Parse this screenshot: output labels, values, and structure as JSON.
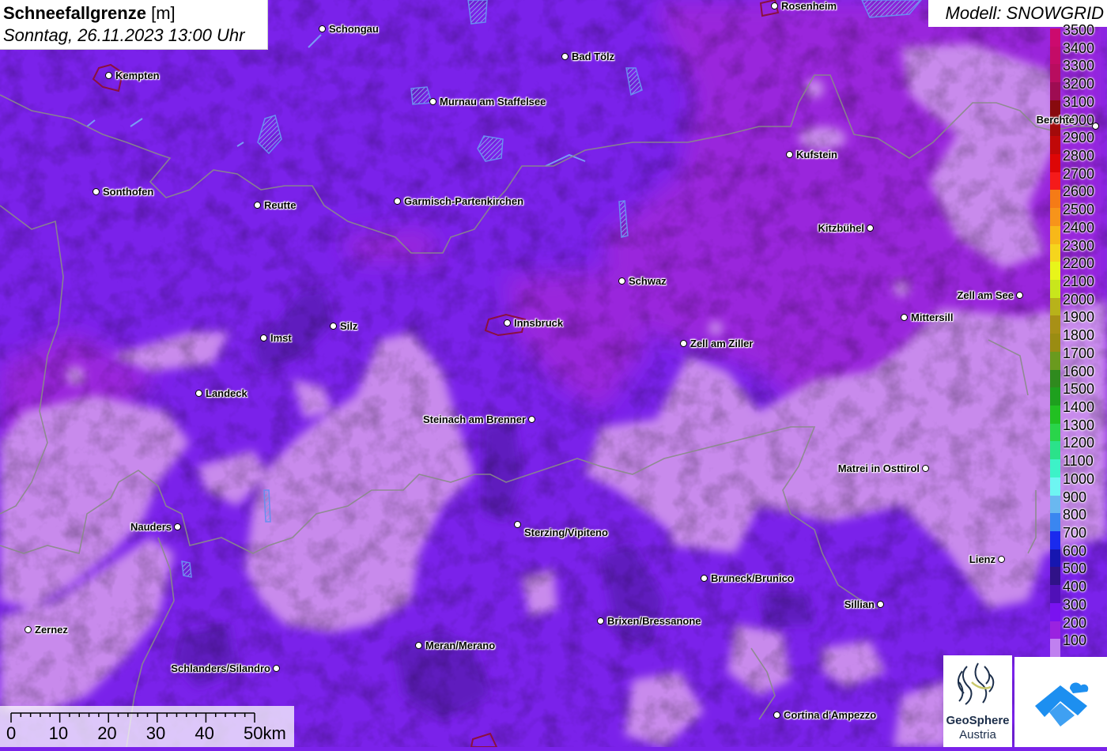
{
  "title": {
    "main": "Schneefallgrenze",
    "unit": "[m]",
    "date": "Sonntag, 26.11.2023 13:00 Uhr"
  },
  "model": {
    "label": "Modell: SNOWGRID"
  },
  "legend": [
    {
      "value": "3500",
      "color": "#cc0a6e"
    },
    {
      "value": "3400",
      "color": "#c40b67"
    },
    {
      "value": "3300",
      "color": "#b80d5f"
    },
    {
      "value": "3200",
      "color": "#9e0c52"
    },
    {
      "value": "3100",
      "color": "#880a0e"
    },
    {
      "value": "3000",
      "color": "#a30a0a"
    },
    {
      "value": "2900",
      "color": "#c00808"
    },
    {
      "value": "2800",
      "color": "#dd0606"
    },
    {
      "value": "2700",
      "color": "#f51a1a"
    },
    {
      "value": "2600",
      "color": "#f57b16"
    },
    {
      "value": "2500",
      "color": "#f7941a"
    },
    {
      "value": "2400",
      "color": "#f7b819"
    },
    {
      "value": "2300",
      "color": "#f5d51d"
    },
    {
      "value": "2200",
      "color": "#e8f51a"
    },
    {
      "value": "2100",
      "color": "#c8e61c"
    },
    {
      "value": "2000",
      "color": "#b8b21a"
    },
    {
      "value": "1900",
      "color": "#a89016"
    },
    {
      "value": "1800",
      "color": "#9a8c12"
    },
    {
      "value": "1700",
      "color": "#6a9a1e"
    },
    {
      "value": "1600",
      "color": "#2f8a1e"
    },
    {
      "value": "1500",
      "color": "#1ea01e"
    },
    {
      "value": "1400",
      "color": "#22c022"
    },
    {
      "value": "1300",
      "color": "#2ad44a"
    },
    {
      "value": "1200",
      "color": "#2be28a"
    },
    {
      "value": "1100",
      "color": "#3df2c8"
    },
    {
      "value": "1000",
      "color": "#6ef5f2"
    },
    {
      "value": "900",
      "color": "#6ab8f0"
    },
    {
      "value": "800",
      "color": "#3a86f0"
    },
    {
      "value": "700",
      "color": "#1a2aee"
    },
    {
      "value": "600",
      "color": "#1616b0"
    },
    {
      "value": "500",
      "color": "#301288"
    },
    {
      "value": "400",
      "color": "#5010b8"
    },
    {
      "value": "300",
      "color": "#7a12f0"
    },
    {
      "value": "200",
      "color": "#9a22e0"
    },
    {
      "value": "100",
      "color": "#c080f0"
    }
  ],
  "cities": [
    {
      "name": "Rosenheim"
    },
    {
      "name": "Schongau"
    },
    {
      "name": "Bad Tölz"
    },
    {
      "name": "Kempten"
    },
    {
      "name": "Murnau am Staffelsee"
    },
    {
      "name": "Berchte"
    },
    {
      "name": "Kufstein"
    },
    {
      "name": "Sonthofen"
    },
    {
      "name": "Reutte"
    },
    {
      "name": "Garmisch-Partenkirchen"
    },
    {
      "name": "Kitzbühel"
    },
    {
      "name": "Schwaz"
    },
    {
      "name": "Zell am See"
    },
    {
      "name": "Mittersill"
    },
    {
      "name": "Silz"
    },
    {
      "name": "Innsbruck"
    },
    {
      "name": "Imst"
    },
    {
      "name": "Zell am Ziller"
    },
    {
      "name": "Landeck"
    },
    {
      "name": "Steinach am Brenner"
    },
    {
      "name": "Matrei in Osttirol"
    },
    {
      "name": "Nauders"
    },
    {
      "name": "Sterzing/Vipiteno"
    },
    {
      "name": "Lienz"
    },
    {
      "name": "Bruneck/Brunico"
    },
    {
      "name": "Sillian"
    },
    {
      "name": "Brixen/Bressanone"
    },
    {
      "name": "Zernez"
    },
    {
      "name": "Meran/Merano"
    },
    {
      "name": "Schlanders/Silandro"
    },
    {
      "name": "Cortina d'Ampezzo"
    }
  ],
  "scale": {
    "labels": [
      "0",
      "10",
      "20",
      "30",
      "40",
      "50km"
    ]
  },
  "logos": {
    "geosphere_name": "GeoSphere",
    "geosphere_sub": "Austria"
  }
}
